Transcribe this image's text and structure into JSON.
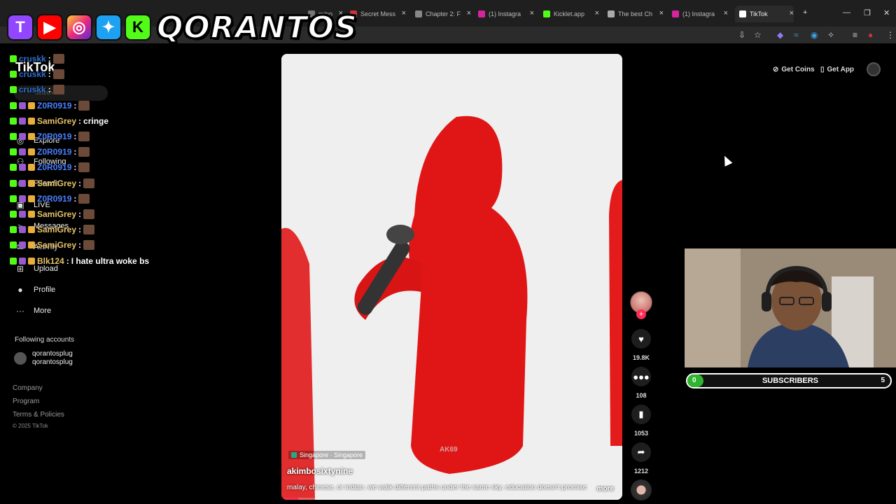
{
  "browser": {
    "tabs": [
      {
        "label": "m/po",
        "color": "#777"
      },
      {
        "label": "Secret Mess",
        "color": "#c33"
      },
      {
        "label": "Chapter 2: F",
        "color": "#888"
      },
      {
        "label": "(1) Instagra",
        "color": "#d6249f"
      },
      {
        "label": "Kicklet.app",
        "color": "#53fc18"
      },
      {
        "label": "The best Ch",
        "color": "#aaa"
      },
      {
        "label": "(1) Instagra",
        "color": "#d6249f"
      },
      {
        "label": "TikTok",
        "color": "#fff"
      }
    ],
    "new_tab": "+",
    "minimize": "—",
    "restore": "❐",
    "close": "✕"
  },
  "banner": {
    "brand": "QORANTOS",
    "twitch": "T",
    "youtube": "▶",
    "instagram": "◎",
    "twitter": "✦",
    "kick": "K"
  },
  "tiktok": {
    "logo": "TikTok",
    "search_placeholder": "Search",
    "nav": [
      {
        "label": "Explore",
        "icon": "◎"
      },
      {
        "label": "Following",
        "icon": "⚇"
      },
      {
        "label": "Friends",
        "icon": "☺"
      },
      {
        "label": "LIVE",
        "icon": "▣"
      },
      {
        "label": "Messages",
        "icon": "➢"
      },
      {
        "label": "Activity",
        "icon": "✉"
      },
      {
        "label": "Upload",
        "icon": "⊞"
      },
      {
        "label": "Profile",
        "icon": "●"
      },
      {
        "label": "More",
        "icon": "···"
      }
    ],
    "following_accounts_title": "Following accounts",
    "account": {
      "name": "qorantosplug",
      "handle": "qorantosplug"
    },
    "footer": [
      "Company",
      "Program",
      "Terms & Policies"
    ],
    "copyright": "© 2025 TikTok",
    "get_coins": "Get Coins",
    "get_app": "Get App"
  },
  "chat": [
    {
      "user": "cruskk",
      "color": "#2f6fd0",
      "msg": ""
    },
    {
      "user": "cruskk",
      "color": "#2f6fd0",
      "msg": ""
    },
    {
      "user": "cruskk",
      "color": "#2f6fd0",
      "msg": ""
    },
    {
      "user": "Z0R0919",
      "color": "#4a80ff",
      "msg": ""
    },
    {
      "user": "SamiGrey",
      "color": "#e8c36a",
      "msg": "cringe"
    },
    {
      "user": "Z0R0919",
      "color": "#4a80ff",
      "msg": ""
    },
    {
      "user": "Z0R0919",
      "color": "#4a80ff",
      "msg": ""
    },
    {
      "user": "Z0R0919",
      "color": "#4a80ff",
      "msg": ""
    },
    {
      "user": "SamiGrey",
      "color": "#e8c36a",
      "msg": ""
    },
    {
      "user": "Z0R0919",
      "color": "#4a80ff",
      "msg": ""
    },
    {
      "user": "SamiGrey",
      "color": "#e8c36a",
      "msg": ""
    },
    {
      "user": "SamiGrey",
      "color": "#e8c36a",
      "msg": ""
    },
    {
      "user": "SamiGrey",
      "color": "#e8c36a",
      "msg": ""
    },
    {
      "user": "Blk124",
      "color": "#e8c36a",
      "msg": "I hate ultra woke bs"
    }
  ],
  "video": {
    "location": "Singapore · Singapore",
    "author": "akimbosixtynine",
    "caption": "malay, chinese, or indian. we walk different paths under the same sky. education doesn't promise",
    "more": "more",
    "watermark": "AK69",
    "progress": 0.05
  },
  "actions": {
    "likes": "19.8K",
    "comments": "108",
    "saves": "1053",
    "shares": "1212"
  },
  "subs_goal": {
    "label": "SUBSCRIBERS",
    "current": "0",
    "target": "5",
    "fill_fraction": 0.08
  }
}
